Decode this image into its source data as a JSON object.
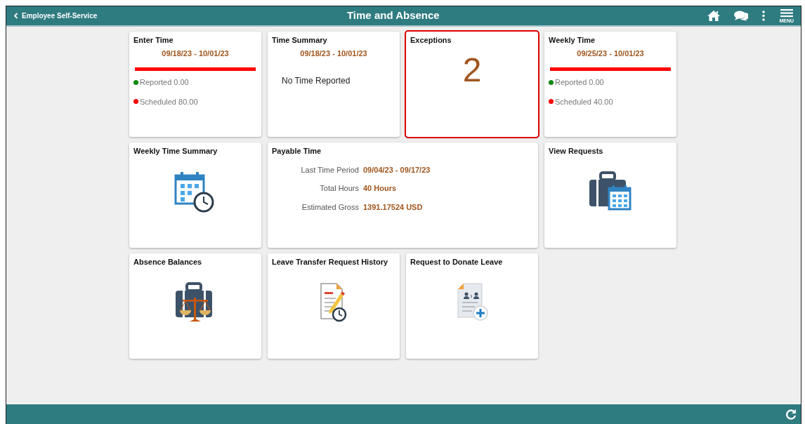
{
  "header": {
    "back_label": "Employee Self-Service",
    "title": "Time and Absence",
    "menu_label": "MENU"
  },
  "tiles": [
    {
      "kind": "period",
      "title": "Enter Time",
      "period": "09/18/23 - 10/01/23",
      "legend": [
        {
          "label": "Reported 0.00",
          "color": "#138a13"
        },
        {
          "label": "Scheduled 80.00",
          "color": "#ff0000"
        }
      ]
    },
    {
      "kind": "summary",
      "title": "Time Summary",
      "period": "09/18/23 - 10/01/23",
      "message": "No Time Reported"
    },
    {
      "kind": "count",
      "title": "Exceptions",
      "count": "2",
      "highlighted": true
    },
    {
      "kind": "period",
      "title": "Weekly Time",
      "period": "09/25/23 - 10/01/23",
      "legend": [
        {
          "label": "Reported 0.00",
          "color": "#138a13"
        },
        {
          "label": "Scheduled 40.00",
          "color": "#ff0000"
        }
      ]
    },
    {
      "kind": "icon",
      "title": "Weekly Time Summary"
    },
    {
      "kind": "payable",
      "title": "Payable Time",
      "rows": [
        {
          "label": "Last Time Period",
          "value": "09/04/23 - 09/17/23"
        },
        {
          "label": "Total Hours",
          "value": "40 Hours"
        },
        {
          "label": "Estimated Gross",
          "value": "1391.17524 USD"
        }
      ]
    },
    {
      "kind": "icon",
      "title": "View Requests"
    },
    {
      "kind": "icon",
      "title": "Absence Balances"
    },
    {
      "kind": "icon",
      "title": "Leave Transfer Request History"
    },
    {
      "kind": "icon",
      "title": "Request to Donate Leave"
    }
  ]
}
